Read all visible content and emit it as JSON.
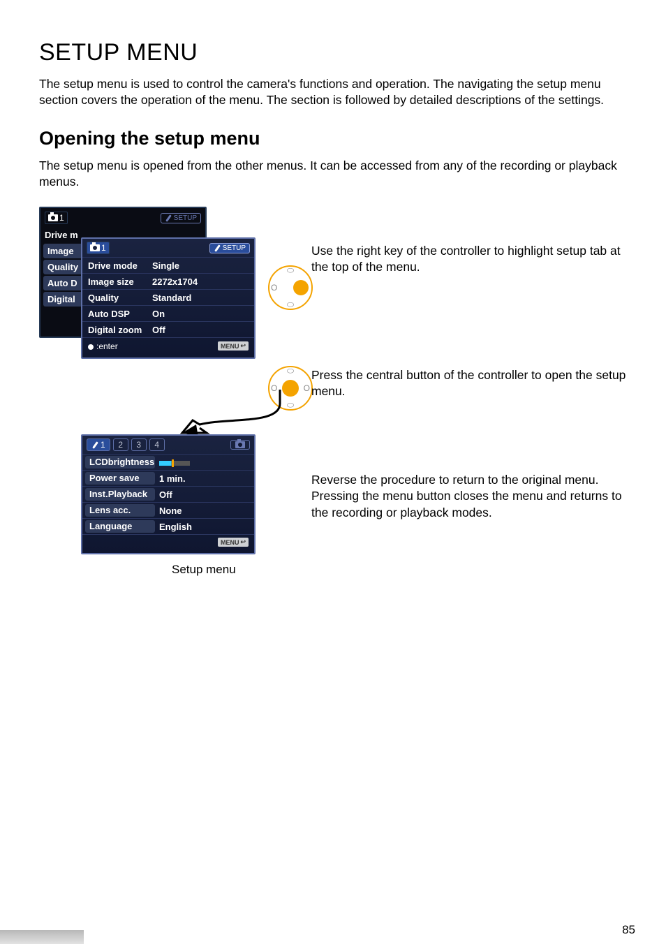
{
  "title": "SETUP MENU",
  "intro": "The setup menu is used to control the camera's functions and operation. The navigating the setup menu section covers the operation of the menu. The section is followed by detailed descriptions of the settings.",
  "subtitle": "Opening the setup menu",
  "sub_intro": "The setup menu is opened from the other menus. It can be accessed from any of the recording or playback menus.",
  "back_menu": {
    "tab_number": "1",
    "setup_tag": "SETUP",
    "items": [
      "Drive m",
      "Image",
      "Quality",
      "Auto D",
      "Digital"
    ]
  },
  "front_menu": {
    "tab_number": "1",
    "setup_tag": "SETUP",
    "rows": [
      {
        "k": "Drive mode",
        "v": "Single"
      },
      {
        "k": "Image size",
        "v": "2272x1704"
      },
      {
        "k": "Quality",
        "v": "Standard"
      },
      {
        "k": "Auto DSP",
        "v": "On"
      },
      {
        "k": "Digital zoom",
        "v": "Off"
      }
    ],
    "enter_label": ":enter",
    "menu_chip": "MENU"
  },
  "setup_menu": {
    "tab1": "1",
    "tabs": [
      "2",
      "3",
      "4"
    ],
    "rows": [
      {
        "k": "LCDbrightness",
        "v": ""
      },
      {
        "k": "Power save",
        "v": "1 min."
      },
      {
        "k": "Inst.Playback",
        "v": "Off"
      },
      {
        "k": "Lens acc.",
        "v": "None"
      },
      {
        "k": "Language",
        "v": "English"
      }
    ],
    "menu_chip": "MENU"
  },
  "explain1": "Use the right key of the controller to highlight setup tab at the top of the menu.",
  "explain2": "Press the central button of the controller to open the setup menu.",
  "explain3": "Reverse the procedure to return to the original menu. Pressing the menu button closes the menu and returns to the recording or playback modes.",
  "caption": "Setup menu",
  "page_number": "85"
}
